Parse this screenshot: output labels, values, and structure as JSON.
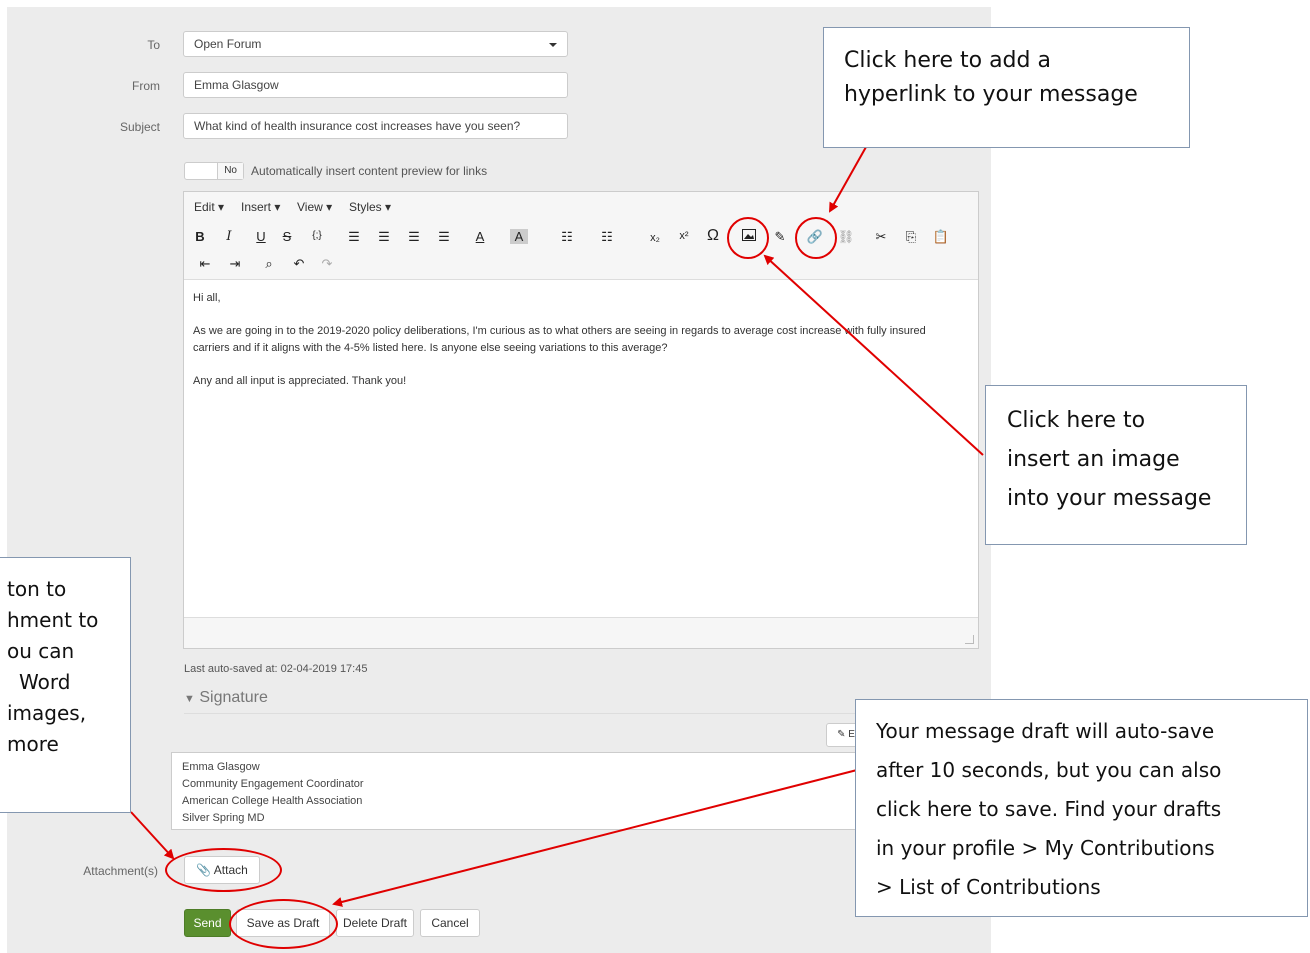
{
  "form": {
    "to_label": "To",
    "to_value": "Open Forum",
    "from_label": "From",
    "from_value": "Emma Glasgow",
    "subject_label": "Subject",
    "subject_value": "What kind of health insurance cost increases have you seen?",
    "toggle_value": "No",
    "toggle_label": "Automatically insert content preview for links"
  },
  "editor": {
    "menus": [
      "Edit ▾",
      "Insert ▾",
      "View ▾",
      "Styles ▾"
    ],
    "body": [
      "Hi all,",
      "As we are going in to the 2019-2020 policy deliberations, I'm curious as to what others are seeing in regards to average cost increase with fully insured carriers and if it aligns with the 4-5% listed here. Is anyone else seeing variations to this average?",
      "Any and all input is appreciated. Thank you!"
    ]
  },
  "autosave": "Last auto-saved at: 02-04-2019 17:45",
  "signature": {
    "heading": "Signature",
    "edit_label": "E",
    "lines": [
      "Emma Glasgow",
      "Community Engagement Coordinator",
      "American College Health Association",
      "Silver Spring MD"
    ]
  },
  "attachments": {
    "label": "Attachment(s)",
    "button": "Attach"
  },
  "actions": {
    "send": "Send",
    "save_draft": "Save as Draft",
    "delete_draft": "Delete Draft",
    "cancel": "Cancel"
  },
  "callouts": {
    "hyperlink": [
      "Click here to add a",
      "hyperlink to your message"
    ],
    "image": [
      "Click here to",
      "insert an image",
      "into your message"
    ],
    "attach": [
      "ton to",
      "hment to",
      "ou can",
      "Word",
      "images,",
      "more"
    ],
    "draft": [
      "Your message draft will auto-save",
      "after 10 seconds, but you can also",
      "click here to save. Find your drafts",
      "in your profile > My Contributions",
      "> List of Contributions"
    ]
  },
  "colors": {
    "send_button": "#5a8f2e",
    "annotation": "#e00000",
    "callout_border": "#8497b0"
  }
}
